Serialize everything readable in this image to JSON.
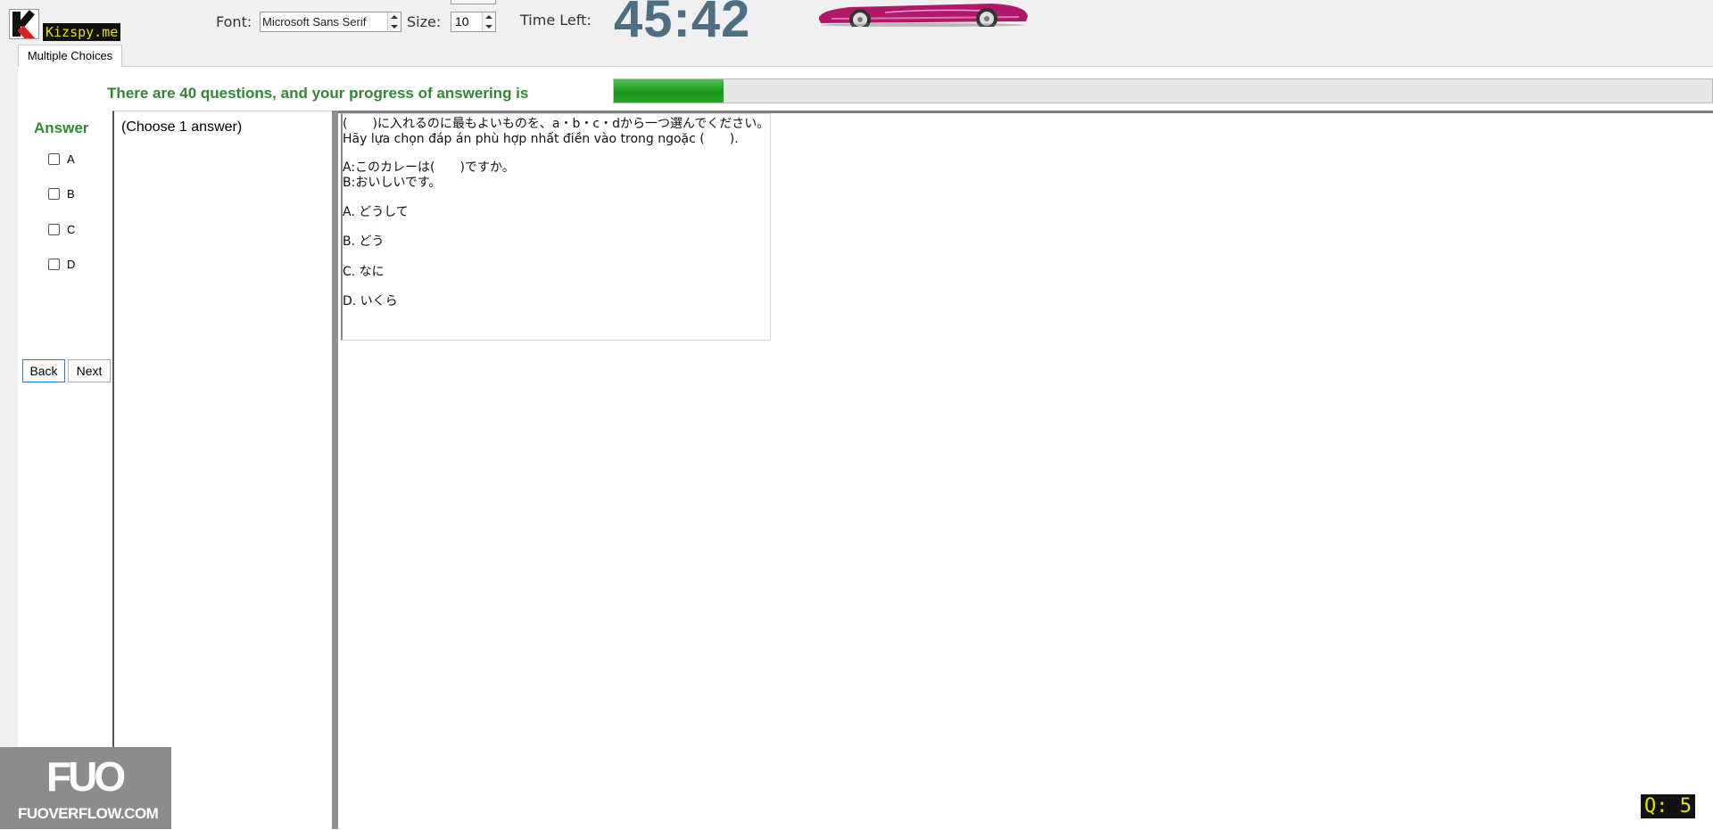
{
  "app": {
    "logo_text": "Kizspy.me"
  },
  "toolbar": {
    "font_label": "Font:",
    "font_value": "Microsoft Sans Serif",
    "size_label": "Size:",
    "size_value": "10",
    "time_label": "Time Left:",
    "timer": "45:42"
  },
  "tab": {
    "label": "Multiple Choices"
  },
  "progress": {
    "text": "There are 40 questions, and your progress of answering is",
    "fraction": 0.1,
    "fill_color": "#1c961c"
  },
  "answer": {
    "title": "Answer",
    "options": [
      "A",
      "B",
      "C",
      "D"
    ],
    "back_label": "Back",
    "next_label": "Next"
  },
  "instructions": {
    "text": "(Choose 1 answer)"
  },
  "question": {
    "line1": "(　　)に入れるのに最もよいものを、a・b・c・dから一つ選んでください。",
    "line2": "Hãy lựa chọn đáp án phù hợp nhất điền vào trong ngoặc (　　).",
    "dialog_a": "A:このカレーは(　　)ですか。",
    "dialog_b": "B:おいしいです。",
    "choices": [
      "A. どうして",
      "B. どう",
      "C. なに",
      "D. いくら"
    ]
  },
  "watermark": {
    "logo": "FUO",
    "site": "FUOVERFLOW.COM"
  },
  "counter": {
    "label": "Q: 5"
  },
  "colors": {
    "accent_green": "#2d8a2d",
    "timer_blue": "#4f6e82",
    "car_magenta": "#b0186a"
  }
}
